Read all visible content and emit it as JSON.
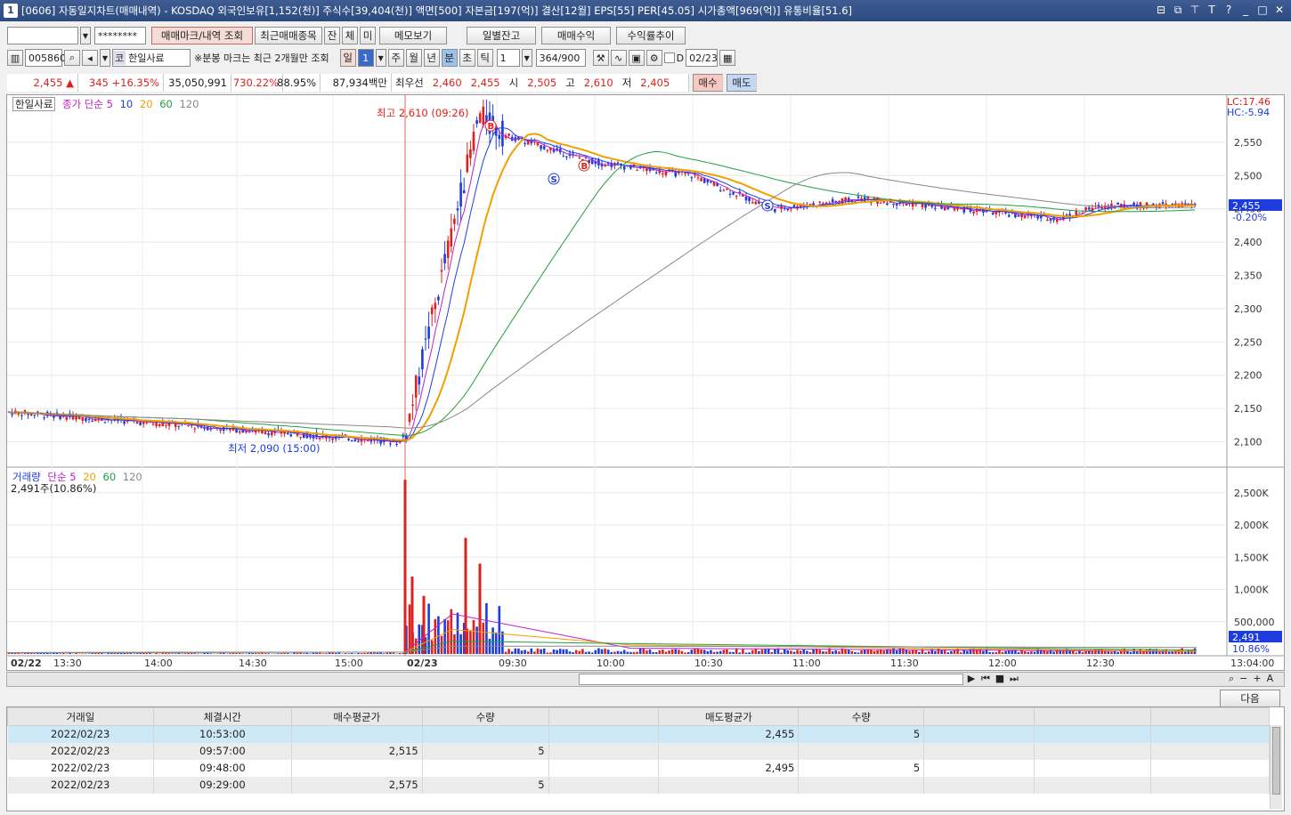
{
  "window": {
    "title": "[0606] 자동일지차트(매매내역) - KOSDAQ 외국인보유[1,152(천)] 주식수[39,404(천)] 액면[500] 자본금[197(억)] 결산[12월] EPS[55] PER[45.05] 시가총액[969(억)] 유통비율[51.6]",
    "badge": "1"
  },
  "toolbar1": {
    "account_value": "",
    "password_mask": "********",
    "buttons": [
      "매매마크/내역 조회",
      "최근매매종목",
      "잔",
      "체",
      "미",
      "메모보기"
    ],
    "buttons_right": [
      "일별잔고",
      "매매수익",
      "수익률추이"
    ]
  },
  "toolbar2": {
    "code": "005860",
    "market_badge": "코",
    "stock_name": "한일사료",
    "notice": "※분봉 마크는 최근 2개월만 조회",
    "period_label": "일",
    "period_value": "1",
    "periods": [
      "주",
      "월",
      "년",
      "분",
      "초",
      "틱"
    ],
    "interval": "1",
    "count": "364/900",
    "date_checkbox_label": "D",
    "date": "02/23"
  },
  "quote": {
    "price": "2,455",
    "arrow": "▲",
    "change": "345",
    "change_pct": "+16.35%",
    "volume": "35,050,991",
    "vol_pct": "730.22%",
    "ratio": "88.95%",
    "amount": "87,934백만",
    "best_label": "최우선",
    "best_ask": "2,460",
    "best_bid": "2,455",
    "open_label": "시",
    "open": "2,505",
    "high_label": "고",
    "high": "2,610",
    "low_label": "저",
    "low": "2,405",
    "buy_btn": "매수",
    "sell_btn": "매도"
  },
  "chart_data": [
    {
      "type": "candlestick",
      "title": "한일사료",
      "legend": [
        "종가 단순 5",
        "10",
        "20",
        "60",
        "120"
      ],
      "legend_colors": [
        "#c020c0",
        "#2040e0",
        "#f0a000",
        "#20a040",
        "#888888"
      ],
      "yticks": [
        "2,550",
        "2,500",
        "2,450",
        "2,400",
        "2,350",
        "2,300",
        "2,250",
        "2,200",
        "2,150",
        "2,100"
      ],
      "ylim": [
        2070,
        2610
      ],
      "lc": "LC:17.46",
      "hc": "HC:-5.94",
      "current_price": "2,455",
      "current_pct": "-0.20%",
      "annotations": [
        "최고 2,610 (09:26)",
        "최저 2,090 (15:00)"
      ],
      "marks": [
        {
          "label": "B",
          "time": "09:27"
        },
        {
          "label": "S",
          "time": "09:48"
        },
        {
          "label": "B",
          "time": "09:57"
        },
        {
          "label": "S",
          "time": "10:53"
        }
      ],
      "x": [
        "02/22 13:30",
        "02/22 15:00",
        "02/23 09:00",
        "02/23 09:26",
        "02/23 09:40",
        "02/23 10:00",
        "02/23 10:30",
        "02/23 10:53",
        "02/23 11:30",
        "02/23 12:00",
        "02/23 12:30",
        "02/23 13:04"
      ],
      "close": [
        2145,
        2100,
        2110,
        2590,
        2540,
        2520,
        2500,
        2470,
        2465,
        2450,
        2455,
        2455
      ]
    },
    {
      "type": "bar",
      "title": "거래량",
      "legend": [
        "단순 5",
        "20",
        "60",
        "120"
      ],
      "legend_colors": [
        "#c020c0",
        "#f0a000",
        "#20a040",
        "#888888"
      ],
      "summary": "2,491주(10.86%)",
      "yticks": [
        "2,500K",
        "2,000K",
        "1,500K",
        "1,000K",
        "500,000"
      ],
      "ylim": [
        0,
        2800000
      ],
      "current": "2,491",
      "current_pct": "10.86%",
      "peak_values": [
        2700000,
        1200000,
        1800000,
        1400000,
        900000
      ]
    }
  ],
  "xaxis": {
    "labels": [
      "02/22",
      "13:30",
      "14:00",
      "14:30",
      "15:00",
      "02/23",
      "09:30",
      "10:00",
      "10:30",
      "11:00",
      "11:30",
      "12:00",
      "12:30",
      "13:04:00"
    ]
  },
  "next_button": "다음",
  "table": {
    "headers": [
      "거래일",
      "체결시간",
      "매수평균가",
      "수량",
      "",
      "매도평균가",
      "수량",
      "",
      "",
      ""
    ],
    "rows": [
      [
        "2022/02/23",
        "10:53:00",
        "",
        "",
        "",
        "2,455",
        "5",
        "",
        "",
        ""
      ],
      [
        "2022/02/23",
        "09:57:00",
        "2,515",
        "5",
        "",
        "",
        "",
        "",
        "",
        ""
      ],
      [
        "2022/02/23",
        "09:48:00",
        "",
        "",
        "",
        "2,495",
        "5",
        "",
        "",
        ""
      ],
      [
        "2022/02/23",
        "09:29:00",
        "2,575",
        "5",
        "",
        "",
        "",
        "",
        "",
        ""
      ]
    ]
  }
}
